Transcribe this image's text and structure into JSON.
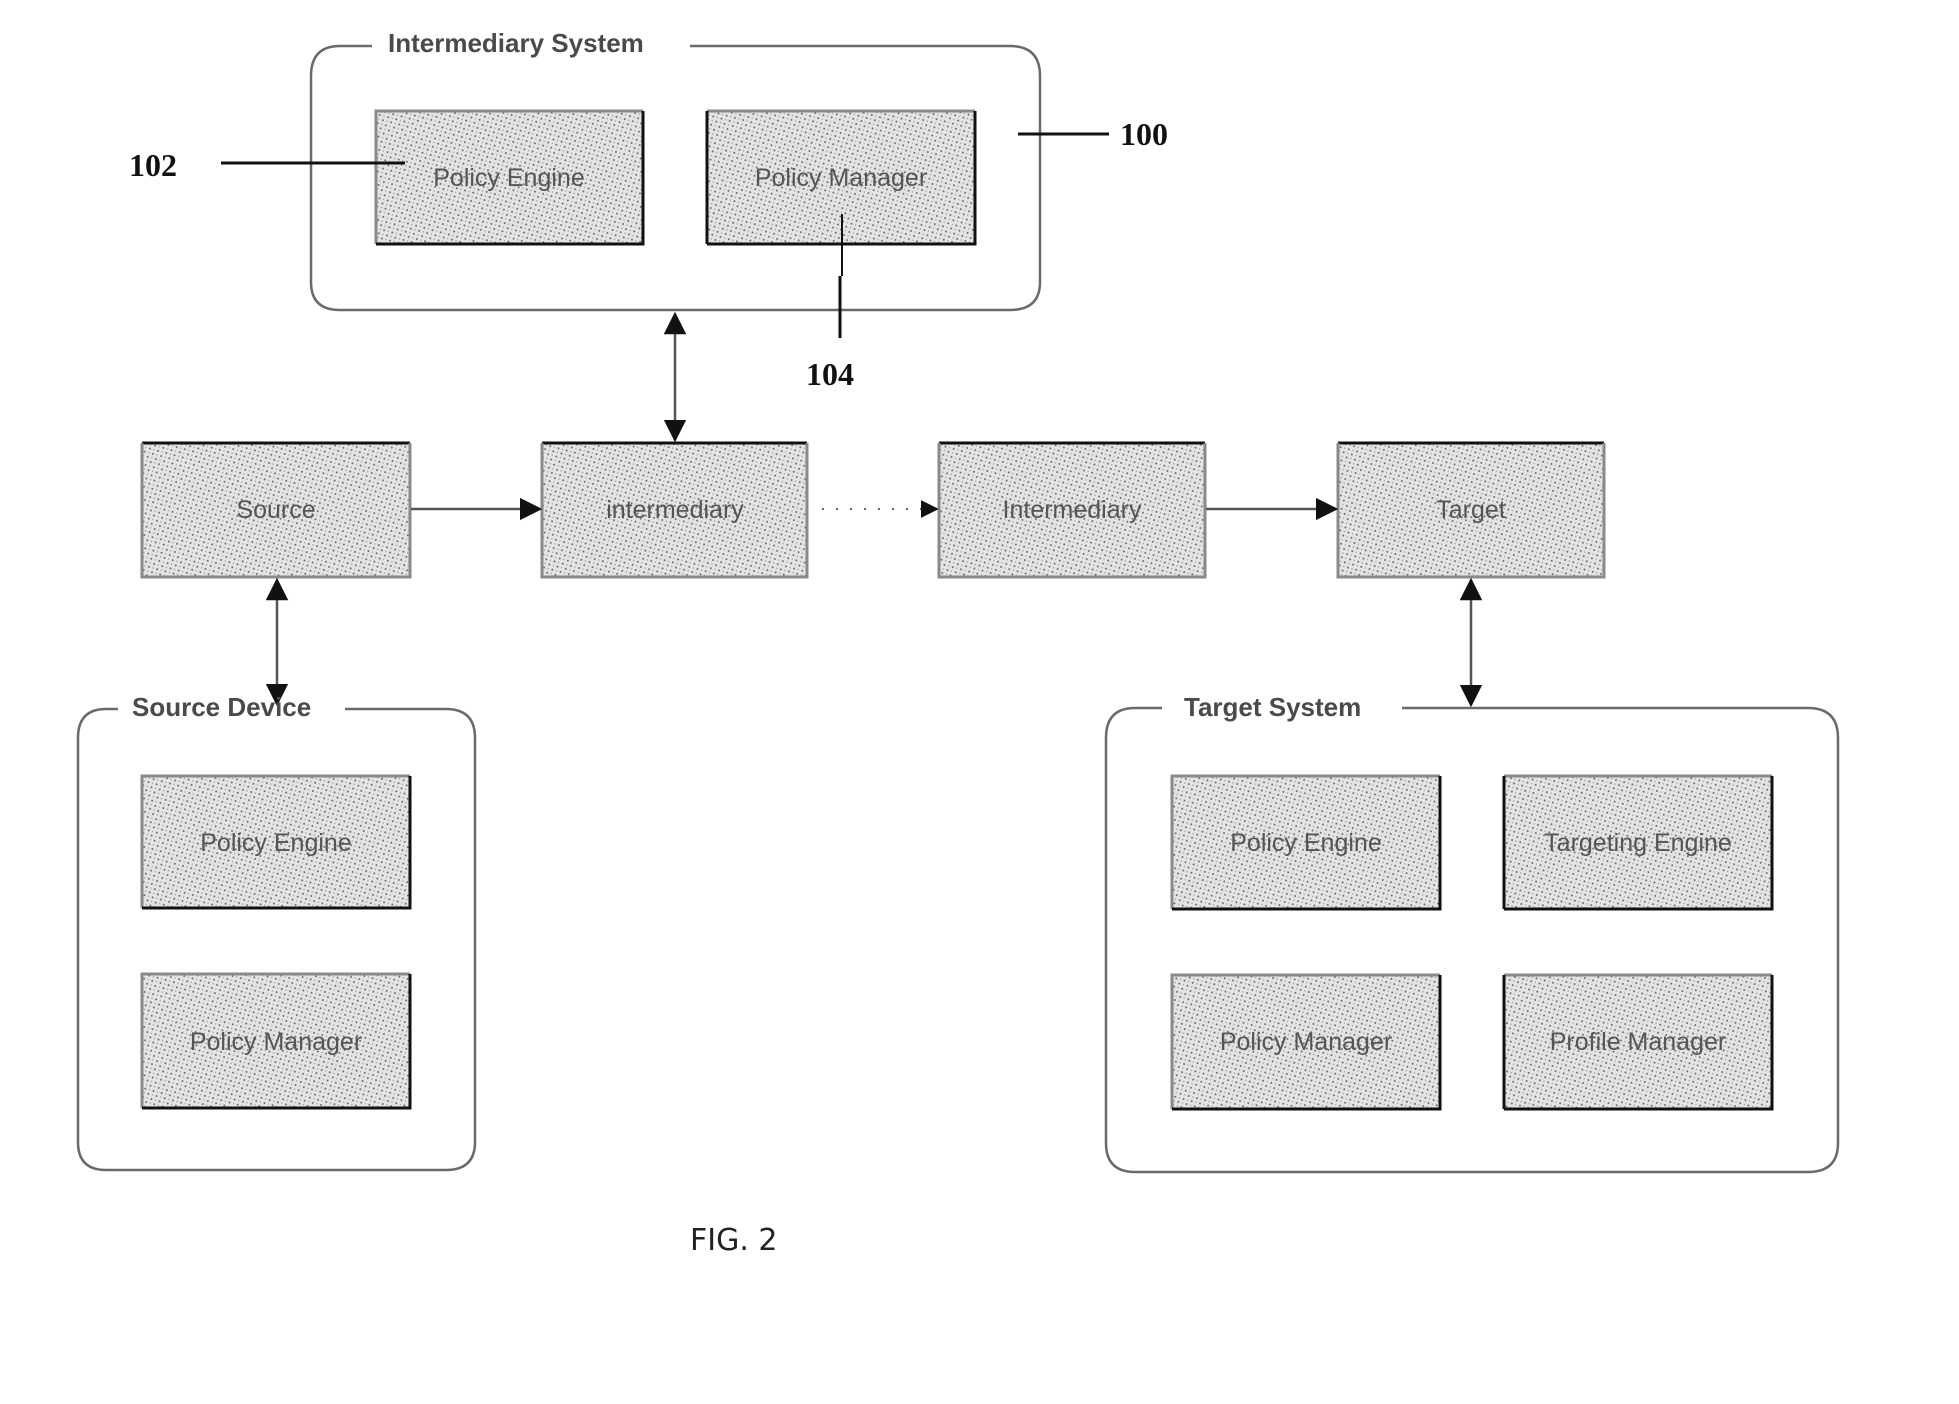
{
  "figure": {
    "caption": "FIG. 2"
  },
  "groups": {
    "intermediary_system": {
      "title": "Intermediary System",
      "components": [
        "Policy Engine",
        "Policy Manager"
      ],
      "reference_numeral": "100"
    },
    "source_device": {
      "title": "Source Device",
      "components": [
        "Policy Engine",
        "Policy Manager"
      ]
    },
    "target_system": {
      "title": "Target System",
      "components": [
        "Policy Engine",
        "Targeting Engine",
        "Policy Manager",
        "Profile Manager"
      ]
    }
  },
  "chain": {
    "nodes": [
      "Source",
      "intermediary",
      "Intermediary",
      "Target"
    ],
    "links": [
      {
        "from": "Source",
        "to": "intermediary",
        "style": "solid"
      },
      {
        "from": "intermediary",
        "to": "Intermediary",
        "style": "dotted"
      },
      {
        "from": "Intermediary",
        "to": "Target",
        "style": "solid"
      }
    ]
  },
  "bidirectional_links": [
    {
      "between": [
        "Intermediary System",
        "intermediary"
      ]
    },
    {
      "between": [
        "Source",
        "Source Device"
      ]
    },
    {
      "between": [
        "Target",
        "Target System"
      ]
    }
  ],
  "reference_numerals": {
    "policy_engine": "102",
    "policy_manager": "104",
    "intermediary_system": "100"
  }
}
